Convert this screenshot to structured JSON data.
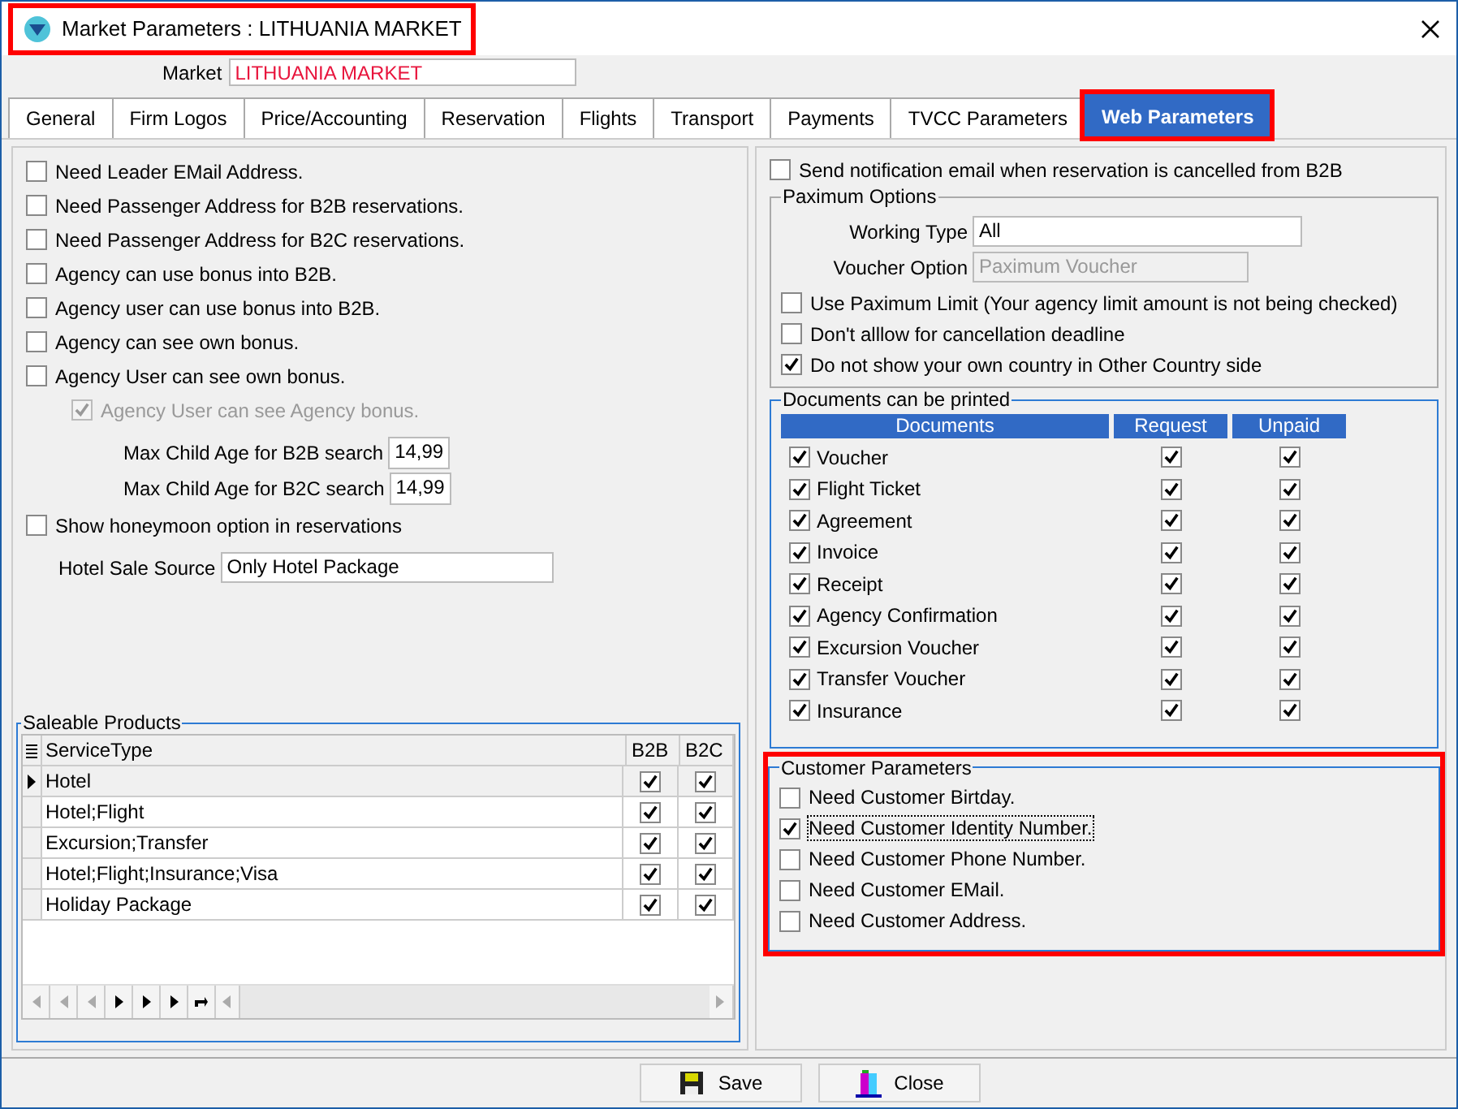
{
  "window": {
    "title": "Market Parameters : LITHUANIA MARKET",
    "highlighted": true
  },
  "market": {
    "label": "Market",
    "value": "LITHUANIA MARKET"
  },
  "tabs": [
    {
      "label": "General",
      "selected": false,
      "highlighted": false
    },
    {
      "label": "Firm Logos",
      "selected": false,
      "highlighted": false
    },
    {
      "label": "Price/Accounting",
      "selected": false,
      "highlighted": false
    },
    {
      "label": "Reservation",
      "selected": false,
      "highlighted": false
    },
    {
      "label": "Flights",
      "selected": false,
      "highlighted": false
    },
    {
      "label": "Transport",
      "selected": false,
      "highlighted": false
    },
    {
      "label": "Payments",
      "selected": false,
      "highlighted": false
    },
    {
      "label": "TVCC Parameters",
      "selected": false,
      "highlighted": false
    },
    {
      "label": "Web Parameters",
      "selected": true,
      "highlighted": true
    }
  ],
  "left_options": [
    {
      "label": "Need Leader EMail Address.",
      "checked": false,
      "disabled": false
    },
    {
      "label": "Need Passenger Address for B2B reservations.",
      "checked": false,
      "disabled": false
    },
    {
      "label": "Need Passenger Address for B2C reservations.",
      "checked": false,
      "disabled": false
    },
    {
      "label": "Agency can use bonus into B2B.",
      "checked": false,
      "disabled": false
    },
    {
      "label": "Agency user can use bonus into B2B.",
      "checked": false,
      "disabled": false
    },
    {
      "label": "Agency can see own bonus.",
      "checked": false,
      "disabled": false
    },
    {
      "label": "Agency User can see own bonus.",
      "checked": false,
      "disabled": false,
      "children": [
        {
          "label": "Agency User can see Agency bonus.",
          "checked": true,
          "disabled": true
        }
      ]
    }
  ],
  "child_age_fields": [
    {
      "label": "Max Child Age for B2B search",
      "value": "14,99"
    },
    {
      "label": "Max Child Age for B2C search",
      "value": "14,99"
    }
  ],
  "honeymoon_option": {
    "label": "Show honeymoon option in reservations",
    "checked": false
  },
  "hotel_sale_source": {
    "label": "Hotel Sale Source",
    "value": "Only Hotel Package"
  },
  "saleable_products": {
    "title": "Saleable Products",
    "columns": [
      "ServiceType",
      "B2B",
      "B2C"
    ],
    "rows": [
      {
        "service_type": "Hotel",
        "b2b": true,
        "b2c": true,
        "selected": true
      },
      {
        "service_type": "Hotel;Flight",
        "b2b": true,
        "b2c": true,
        "selected": false
      },
      {
        "service_type": "Excursion;Transfer",
        "b2b": true,
        "b2c": true,
        "selected": false
      },
      {
        "service_type": "Hotel;Flight;Insurance;Visa",
        "b2b": true,
        "b2c": true,
        "selected": false
      },
      {
        "service_type": "Holiday Package",
        "b2b": true,
        "b2c": true,
        "selected": false
      }
    ]
  },
  "notification_option": {
    "label": "Send notification email when reservation is cancelled from B2B",
    "checked": false
  },
  "paximum_options": {
    "title": "Paximum Options",
    "fields": [
      {
        "label": "Working Type",
        "value": "All",
        "disabled": false
      },
      {
        "label": "Voucher Option",
        "value": "Paximum Voucher",
        "disabled": true
      }
    ],
    "options": [
      {
        "label": "Use Paximum Limit  (Your agency limit amount is not being checked)",
        "checked": false
      },
      {
        "label": "Don't alllow for cancellation deadline",
        "checked": false
      },
      {
        "label": "Do not show your own country in Other Country side",
        "checked": true
      }
    ]
  },
  "documents": {
    "title": "Documents can be printed",
    "columns": [
      "Documents",
      "Request",
      "Unpaid"
    ],
    "rows": [
      {
        "name": "Voucher",
        "checked": true,
        "request": true,
        "unpaid": true
      },
      {
        "name": "Flight Ticket",
        "checked": true,
        "request": true,
        "unpaid": true
      },
      {
        "name": "Agreement",
        "checked": true,
        "request": true,
        "unpaid": true
      },
      {
        "name": "Invoice",
        "checked": true,
        "request": true,
        "unpaid": true
      },
      {
        "name": "Receipt",
        "checked": true,
        "request": true,
        "unpaid": true
      },
      {
        "name": "Agency Confirmation",
        "checked": true,
        "request": true,
        "unpaid": true
      },
      {
        "name": "Excursion Voucher",
        "checked": true,
        "request": true,
        "unpaid": true
      },
      {
        "name": "Transfer Voucher",
        "checked": true,
        "request": true,
        "unpaid": true
      },
      {
        "name": "Insurance",
        "checked": true,
        "request": true,
        "unpaid": true
      }
    ]
  },
  "customer_parameters": {
    "title": "Customer Parameters",
    "highlighted": true,
    "options": [
      {
        "label": "Need Customer Birtday.",
        "checked": false,
        "focused": false
      },
      {
        "label": "Need Customer Identity Number.",
        "checked": true,
        "focused": true
      },
      {
        "label": "Need Customer Phone Number.",
        "checked": false,
        "focused": false
      },
      {
        "label": "Need Customer EMail.",
        "checked": false,
        "focused": false
      },
      {
        "label": "Need Customer Address.",
        "checked": false,
        "focused": false
      }
    ]
  },
  "buttons": [
    {
      "label": "Save",
      "kind": "save"
    },
    {
      "label": "Close",
      "kind": "close"
    }
  ]
}
